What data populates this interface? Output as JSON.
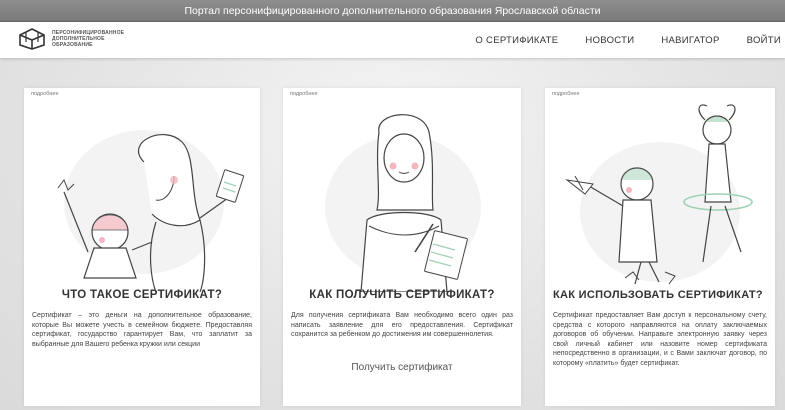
{
  "banner": {
    "text": "Портал персонифицированного дополнительного образования Ярославской области"
  },
  "logo": {
    "line1": "ПЕРСОНИФИЦИРОВАННОЕ",
    "line2": "ДОПОЛНИТЕЛЬНОЕ",
    "line3": "ОБРАЗОВАНИЕ"
  },
  "nav": {
    "items": [
      {
        "label": "О СЕРТИФИКАТЕ"
      },
      {
        "label": "НОВОСТИ"
      },
      {
        "label": "НАВИГАТОР"
      },
      {
        "label": "ВОЙТИ"
      }
    ]
  },
  "cards": [
    {
      "more": "подробнее",
      "title": "ЧТО ТАКОЕ СЕРТИФИКАТ?",
      "text": "Сертификат – это деньги на дополнительное образование, которые Вы можете учесть в семейном бюджете. Предоставляя сертификат, государство гарантирует Вам, что заплатит за выбранные для Вашего ребенка кружки или секции"
    },
    {
      "more": "подробнее",
      "title": "КАК ПОЛУЧИТЬ СЕРТИФИКАТ?",
      "text": "Для получения сертификата Вам необходимо всего один раз написать заявление для его предоставления. Сертификат сохранится за ребенком до достижения им совершеннолетия.",
      "link": "Получить сертификат"
    },
    {
      "more": "подробнее",
      "title": "КАК ИСПОЛЬЗОВАТЬ СЕРТИФИКАТ?",
      "text": "Сертификат предоставляет Вам доступ к персональному счету, средства с которого направляются на оплату заключаемых договоров об обучении. Направьте электронную заявку через свой личный кабинет или назовите номер сертификата непосредственно в организации, и с Вами заключат договор, по которому «платить» будет сертификат."
    }
  ],
  "colors": {
    "banner": "#888888",
    "text": "#333333",
    "pink": "#f2b6bd",
    "green": "#9fd1b4"
  }
}
